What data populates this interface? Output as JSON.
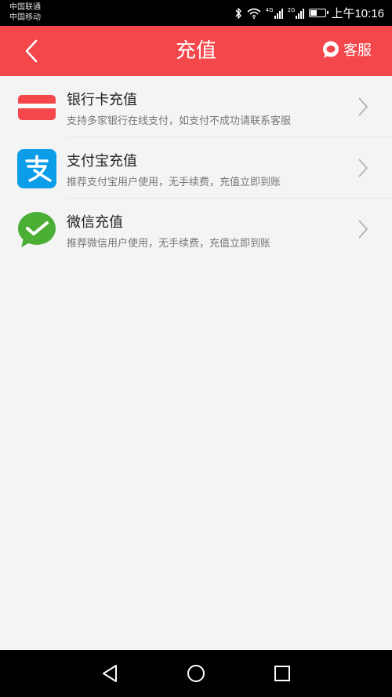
{
  "status_bar": {
    "carrier1": "中国联通",
    "carrier2": "中国移动",
    "net1": "4G",
    "net2": "2G",
    "time": "上午10:16"
  },
  "header": {
    "title": "充值",
    "service_label": "客服",
    "back_icon": "chevron-left-icon",
    "service_icon": "chat-bubble-icon"
  },
  "items": [
    {
      "name": "银行卡充值",
      "desc": "支持多家银行在线支付，如支付不成功请联系客服",
      "icon": "bank-card-icon"
    },
    {
      "name": "支付宝充值",
      "desc": "推荐支付宝用户使用，无手续费，充值立即到账",
      "icon": "alipay-icon"
    },
    {
      "name": "微信充值",
      "desc": "推荐微信用户使用，无手续费，充值立即到账",
      "icon": "wechat-icon"
    }
  ],
  "colors": {
    "header": "#f4474b",
    "alipay": "#0b9de8",
    "wechat": "#4caf35",
    "bank": "#f4474b"
  }
}
